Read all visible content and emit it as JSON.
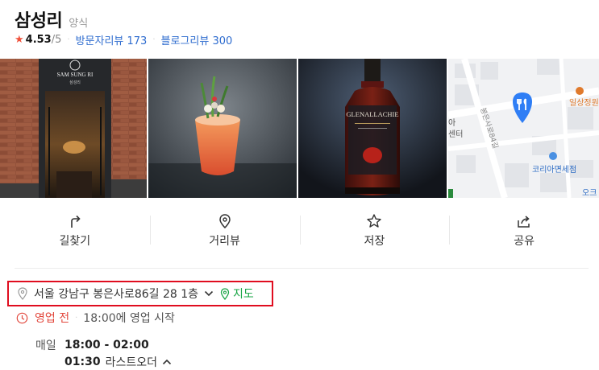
{
  "place": {
    "name": "삼성리",
    "category": "양식"
  },
  "rating": {
    "value": "4.53",
    "max": "/5",
    "visitor_review_label": "방문자리뷰 173",
    "blog_review_label": "블로그리뷰 300"
  },
  "photos": {
    "storefront_sign": "SAM SUNG RI",
    "storefront_sign_sub": "삼성리",
    "bottle_label": "GLENALLACHIE"
  },
  "map_preview": {
    "labels": [
      "일상정원",
      "봉은사로84길",
      "코리아면세점",
      "아",
      "센터",
      "오크"
    ]
  },
  "actions": [
    {
      "label": "길찾기"
    },
    {
      "label": "거리뷰"
    },
    {
      "label": "저장"
    },
    {
      "label": "공유"
    }
  ],
  "address": {
    "text": "서울 강남구 봉은사로86길 28 1층",
    "map_label": "지도"
  },
  "hours": {
    "status": "영업 전",
    "open_text": "18:00에 영업 시작",
    "day": "매일",
    "time": "18:00 - 02:00",
    "last_order_time": "01:30",
    "last_order_label": "라스트오더"
  },
  "colors": {
    "accent_red": "#e2473c",
    "link_blue": "#2e6ccf",
    "map_green": "#18a545",
    "highlight_red": "#e00d1f",
    "map_pin_blue": "#2f7ef5"
  }
}
